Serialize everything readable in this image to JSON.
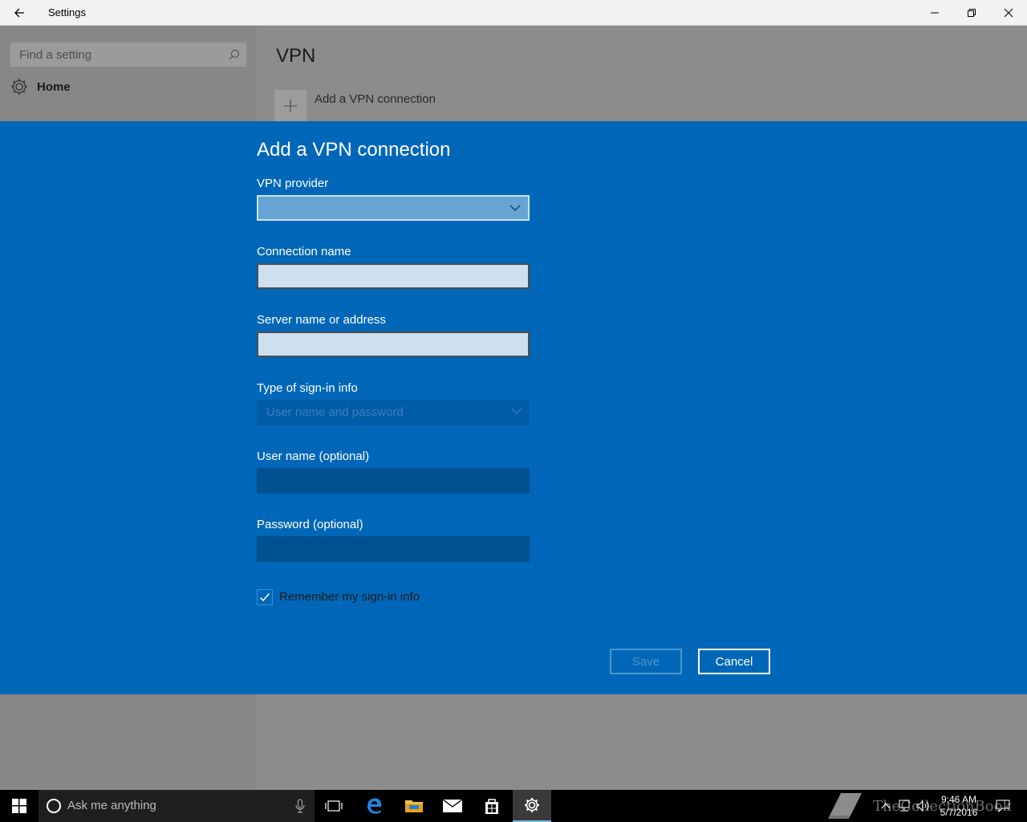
{
  "window": {
    "title": "Settings"
  },
  "sidebar": {
    "search_placeholder": "Find a setting",
    "home_label": "Home"
  },
  "page": {
    "title": "VPN",
    "add_vpn_label": "Add a VPN connection"
  },
  "dialog": {
    "title": "Add a VPN connection",
    "fields": {
      "vpn_provider": {
        "label": "VPN provider",
        "value": ""
      },
      "connection_name": {
        "label": "Connection name",
        "value": ""
      },
      "server": {
        "label": "Server name or address",
        "value": ""
      },
      "signin_type": {
        "label": "Type of sign-in info",
        "value": "User name and password"
      },
      "username": {
        "label": "User name (optional)",
        "value": ""
      },
      "password": {
        "label": "Password (optional)",
        "value": ""
      }
    },
    "remember_label": "Remember my sign-in info",
    "remember_checked": true,
    "save_label": "Save",
    "cancel_label": "Cancel"
  },
  "taskbar": {
    "search_placeholder": "Ask me anything",
    "time": "9:46 AM",
    "date": "5/7/2016",
    "watermark": "TheCollectionBook"
  },
  "colors": {
    "dialog_bg": "#0067b8",
    "accent": "#76b9ed"
  }
}
